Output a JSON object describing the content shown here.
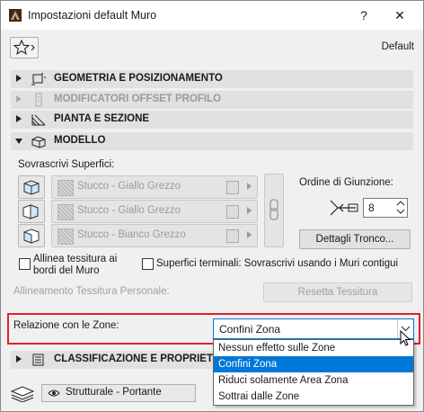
{
  "window": {
    "title": "Impostazioni default Muro",
    "help_label": "?",
    "close_label": "✕"
  },
  "header": {
    "default_label": "Default"
  },
  "sections": [
    {
      "label": "GEOMETRIA E POSIZIONAMENTO",
      "icon": "geometry-icon",
      "state": "collapsed"
    },
    {
      "label": "MODIFICATORI OFFSET PROFILO",
      "icon": "profile-icon",
      "state": "disabled"
    },
    {
      "label": "PIANTA E SEZIONE",
      "icon": "floor-plan-icon",
      "state": "collapsed"
    },
    {
      "label": "MODELLO",
      "icon": "model-box-icon",
      "state": "expanded"
    }
  ],
  "model": {
    "override_label": "Sovrascrivi Superfici:",
    "surfaces": [
      "Stucco - Giallo Grezzo",
      "Stucco - Giallo Grezzo",
      "Stucco - Bianco Grezzo"
    ],
    "join_order_label": "Ordine di Giunzione:",
    "join_order_value": "8",
    "trunk_details_label": "Dettagli Tronco...",
    "align_texture_label_1": "Allinea tessitura ai",
    "align_texture_label_2": "bordi del Muro",
    "end_surfaces_label": "Superfici terminali: Sovrascrivi usando i Muri contigui",
    "custom_align_label": "Allineamento Tessitura Personale:",
    "reset_texture_label": "Resetta Tessitura"
  },
  "zones": {
    "label": "Relazione con le Zone:",
    "selected": "Confini Zona",
    "options": [
      "Nessun effetto sulle Zone",
      "Confini Zona",
      "Riduci solamente Area Zona",
      "Sottrai dalle Zone"
    ],
    "selected_index": 1
  },
  "classification": {
    "label": "CLASSIFICAZIONE E PROPRIETÀ"
  },
  "footer": {
    "structural_value": "Strutturale - Portante"
  },
  "colors": {
    "accent": "#0078d7",
    "highlight_border": "#e2202c",
    "section_bg": "#e1e1e1"
  }
}
